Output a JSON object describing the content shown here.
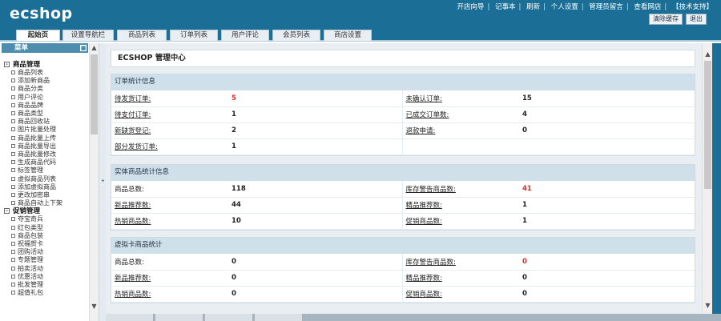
{
  "app": {
    "logo": "ecshop",
    "top_links": [
      "开店向导",
      "记事本",
      "刷新",
      "个人设置",
      "管理员留言",
      "查看网店",
      "【技术支持】"
    ],
    "top_buttons": [
      "清除缓存",
      "退出"
    ]
  },
  "tabs": [
    "起始页",
    "设置导航栏",
    "商品列表",
    "订单列表",
    "用户评论",
    "会员列表",
    "商店设置"
  ],
  "sidebar": {
    "header": "菜单",
    "groups": [
      {
        "title": "商品管理",
        "items": [
          "商品列表",
          "添加新商品",
          "商品分类",
          "用户评论",
          "商品品牌",
          "商品类型",
          "商品回收站",
          "图片批量处理",
          "商品批量上传",
          "商品批量导出",
          "商品批量修改",
          "生成商品代码",
          "标签管理",
          "虚拟商品列表",
          "添加虚拟商品",
          "更改加密串",
          "商品自动上下架"
        ]
      },
      {
        "title": "促销管理",
        "items": [
          "夺宝奇兵",
          "红包类型",
          "商品包装",
          "祝福贺卡",
          "团购活动",
          "专题管理",
          "拍卖活动",
          "优惠活动",
          "批发管理",
          "超值礼包"
        ]
      }
    ]
  },
  "main": {
    "title": "ECSHOP 管理中心",
    "order_stats": {
      "title": "订单统计信息",
      "rows": [
        {
          "l1": "待发货订单:",
          "v1": "5",
          "v1_red": true,
          "l2": "未确认订单:",
          "v2": "15",
          "v2_red": false
        },
        {
          "l1": "待支付订单:",
          "v1": "1",
          "v1_red": false,
          "l2": "已成交订单数:",
          "v2": "4",
          "v2_red": false
        },
        {
          "l1": "新缺货登记:",
          "v1": "2",
          "v1_red": false,
          "l2": "退款申请:",
          "v2": "0",
          "v2_red": false
        },
        {
          "l1": "部分发货订单:",
          "v1": "1",
          "v1_red": false,
          "l2": "",
          "v2": "",
          "v2_red": false
        }
      ]
    },
    "product_stats": {
      "title": "实体商品统计信息",
      "rows": [
        {
          "l1": "商品总数:",
          "v1": "118",
          "v1_red": false,
          "l2": "库存警告商品数:",
          "v2": "41",
          "v2_red": true
        },
        {
          "l1": "新品推荐数:",
          "v1": "44",
          "v1_red": false,
          "l2": "精品推荐数:",
          "v2": "1",
          "v2_red": false
        },
        {
          "l1": "热销商品数:",
          "v1": "10",
          "v1_red": false,
          "l2": "促销商品数:",
          "v2": "1",
          "v2_red": false
        }
      ]
    },
    "virtual_stats": {
      "title": "虚拟卡商品统计",
      "rows": [
        {
          "l1": "商品总数:",
          "v1": "0",
          "v1_red": false,
          "l2": "库存警告商品数:",
          "v2": "0",
          "v2_red": true
        },
        {
          "l1": "新品推荐数:",
          "v1": "0",
          "v1_red": false,
          "l2": "精品推荐数:",
          "v2": "0",
          "v2_red": false
        },
        {
          "l1": "热销商品数:",
          "v1": "0",
          "v1_red": false,
          "l2": "促销商品数:",
          "v2": "0",
          "v2_red": false
        }
      ]
    }
  },
  "colors": {
    "header_bg": "#1b6f97",
    "panel_head": "#cfe0ea",
    "alert_red": "#d0302a"
  }
}
